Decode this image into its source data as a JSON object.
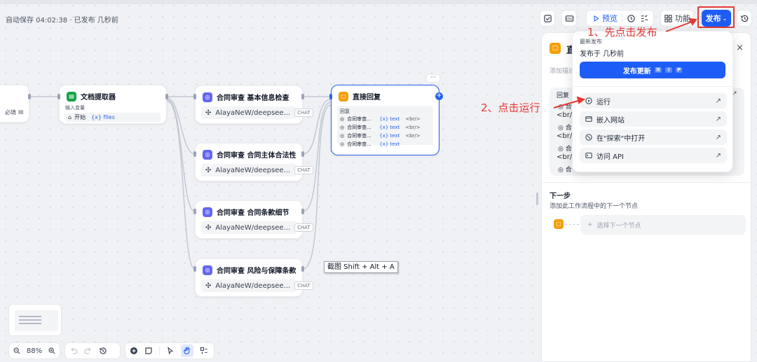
{
  "header": {
    "autosave_text": "自动保存 04:02:38 · 已发布 几秒前",
    "toolbar": {
      "preview_label": "预览",
      "features_label": "功能",
      "publish_label": "发布"
    }
  },
  "canvas": {
    "left_edge_node": {
      "label": "必填"
    },
    "doc_extractor": {
      "title": "文档提取器",
      "input_section": "输入变量",
      "input_source": "开始",
      "input_var": "{x} files"
    },
    "llm_nodes": [
      {
        "title": "合同审查 基本信息检查",
        "model": "AlayaNeW/deepsee...",
        "tag": "CHAT"
      },
      {
        "title": "合同审查 合同主体合法性",
        "model": "AlayaNeW/deepsee...",
        "tag": "CHAT"
      },
      {
        "title": "合同审查 合同条款细节",
        "model": "AlayaNeW/deepsee...",
        "tag": "CHAT"
      },
      {
        "title": "合同审查 风险与保障条款",
        "model": "AlayaNeW/deepsee...",
        "tag": "CHAT"
      }
    ],
    "reply_node": {
      "title": "直接回复",
      "section": "回复",
      "rows": [
        {
          "source": "合同审查...",
          "var": "{x} text",
          "suffix": "<br/>"
        },
        {
          "source": "合同审查...",
          "var": "{x} text",
          "suffix": "<br/>"
        },
        {
          "source": "合同审查...",
          "var": "{x} text",
          "suffix": "<br/>"
        },
        {
          "source": "合同审查...",
          "var": "{x} text",
          "suffix": ""
        }
      ]
    },
    "screenshot_tooltip": "截图 Shift + Alt + A"
  },
  "side_panel": {
    "title_char": "直",
    "add_desc": "添加描述",
    "reply_label": "回复",
    "br_texts": [
      "<br/>",
      "<br/>",
      "<br/>"
    ],
    "row_snippets": [
      "合",
      "合",
      "合",
      "合"
    ],
    "next_step_title": "下一步",
    "next_step_desc": "添加此工作流程中的下一个节点",
    "select_next_placeholder": "选择下一个节点"
  },
  "publish_dropdown": {
    "latest_label": "最新发布",
    "published_at": "发布于 几秒前",
    "update_button": "发布更新",
    "shortcut_keys": [
      "⌘",
      "⇧",
      "P"
    ],
    "items": [
      {
        "label": "运行",
        "icon": "play-icon"
      },
      {
        "label": "嵌入网站",
        "icon": "embed-icon"
      },
      {
        "label": "在\"探索\"中打开",
        "icon": "compass-icon"
      },
      {
        "label": "访问 API",
        "icon": "terminal-icon"
      }
    ]
  },
  "annotations": {
    "step1": "1、先点击发布",
    "step2": "2、点击运行"
  },
  "bottom_bar": {
    "zoom": "88%"
  },
  "colors": {
    "primary": "#1d5cf5",
    "annotation_red": "#e53935",
    "llm_icon": "#6366f1",
    "reply_icon": "#f59e0b",
    "doc_icon": "#16a34a"
  }
}
